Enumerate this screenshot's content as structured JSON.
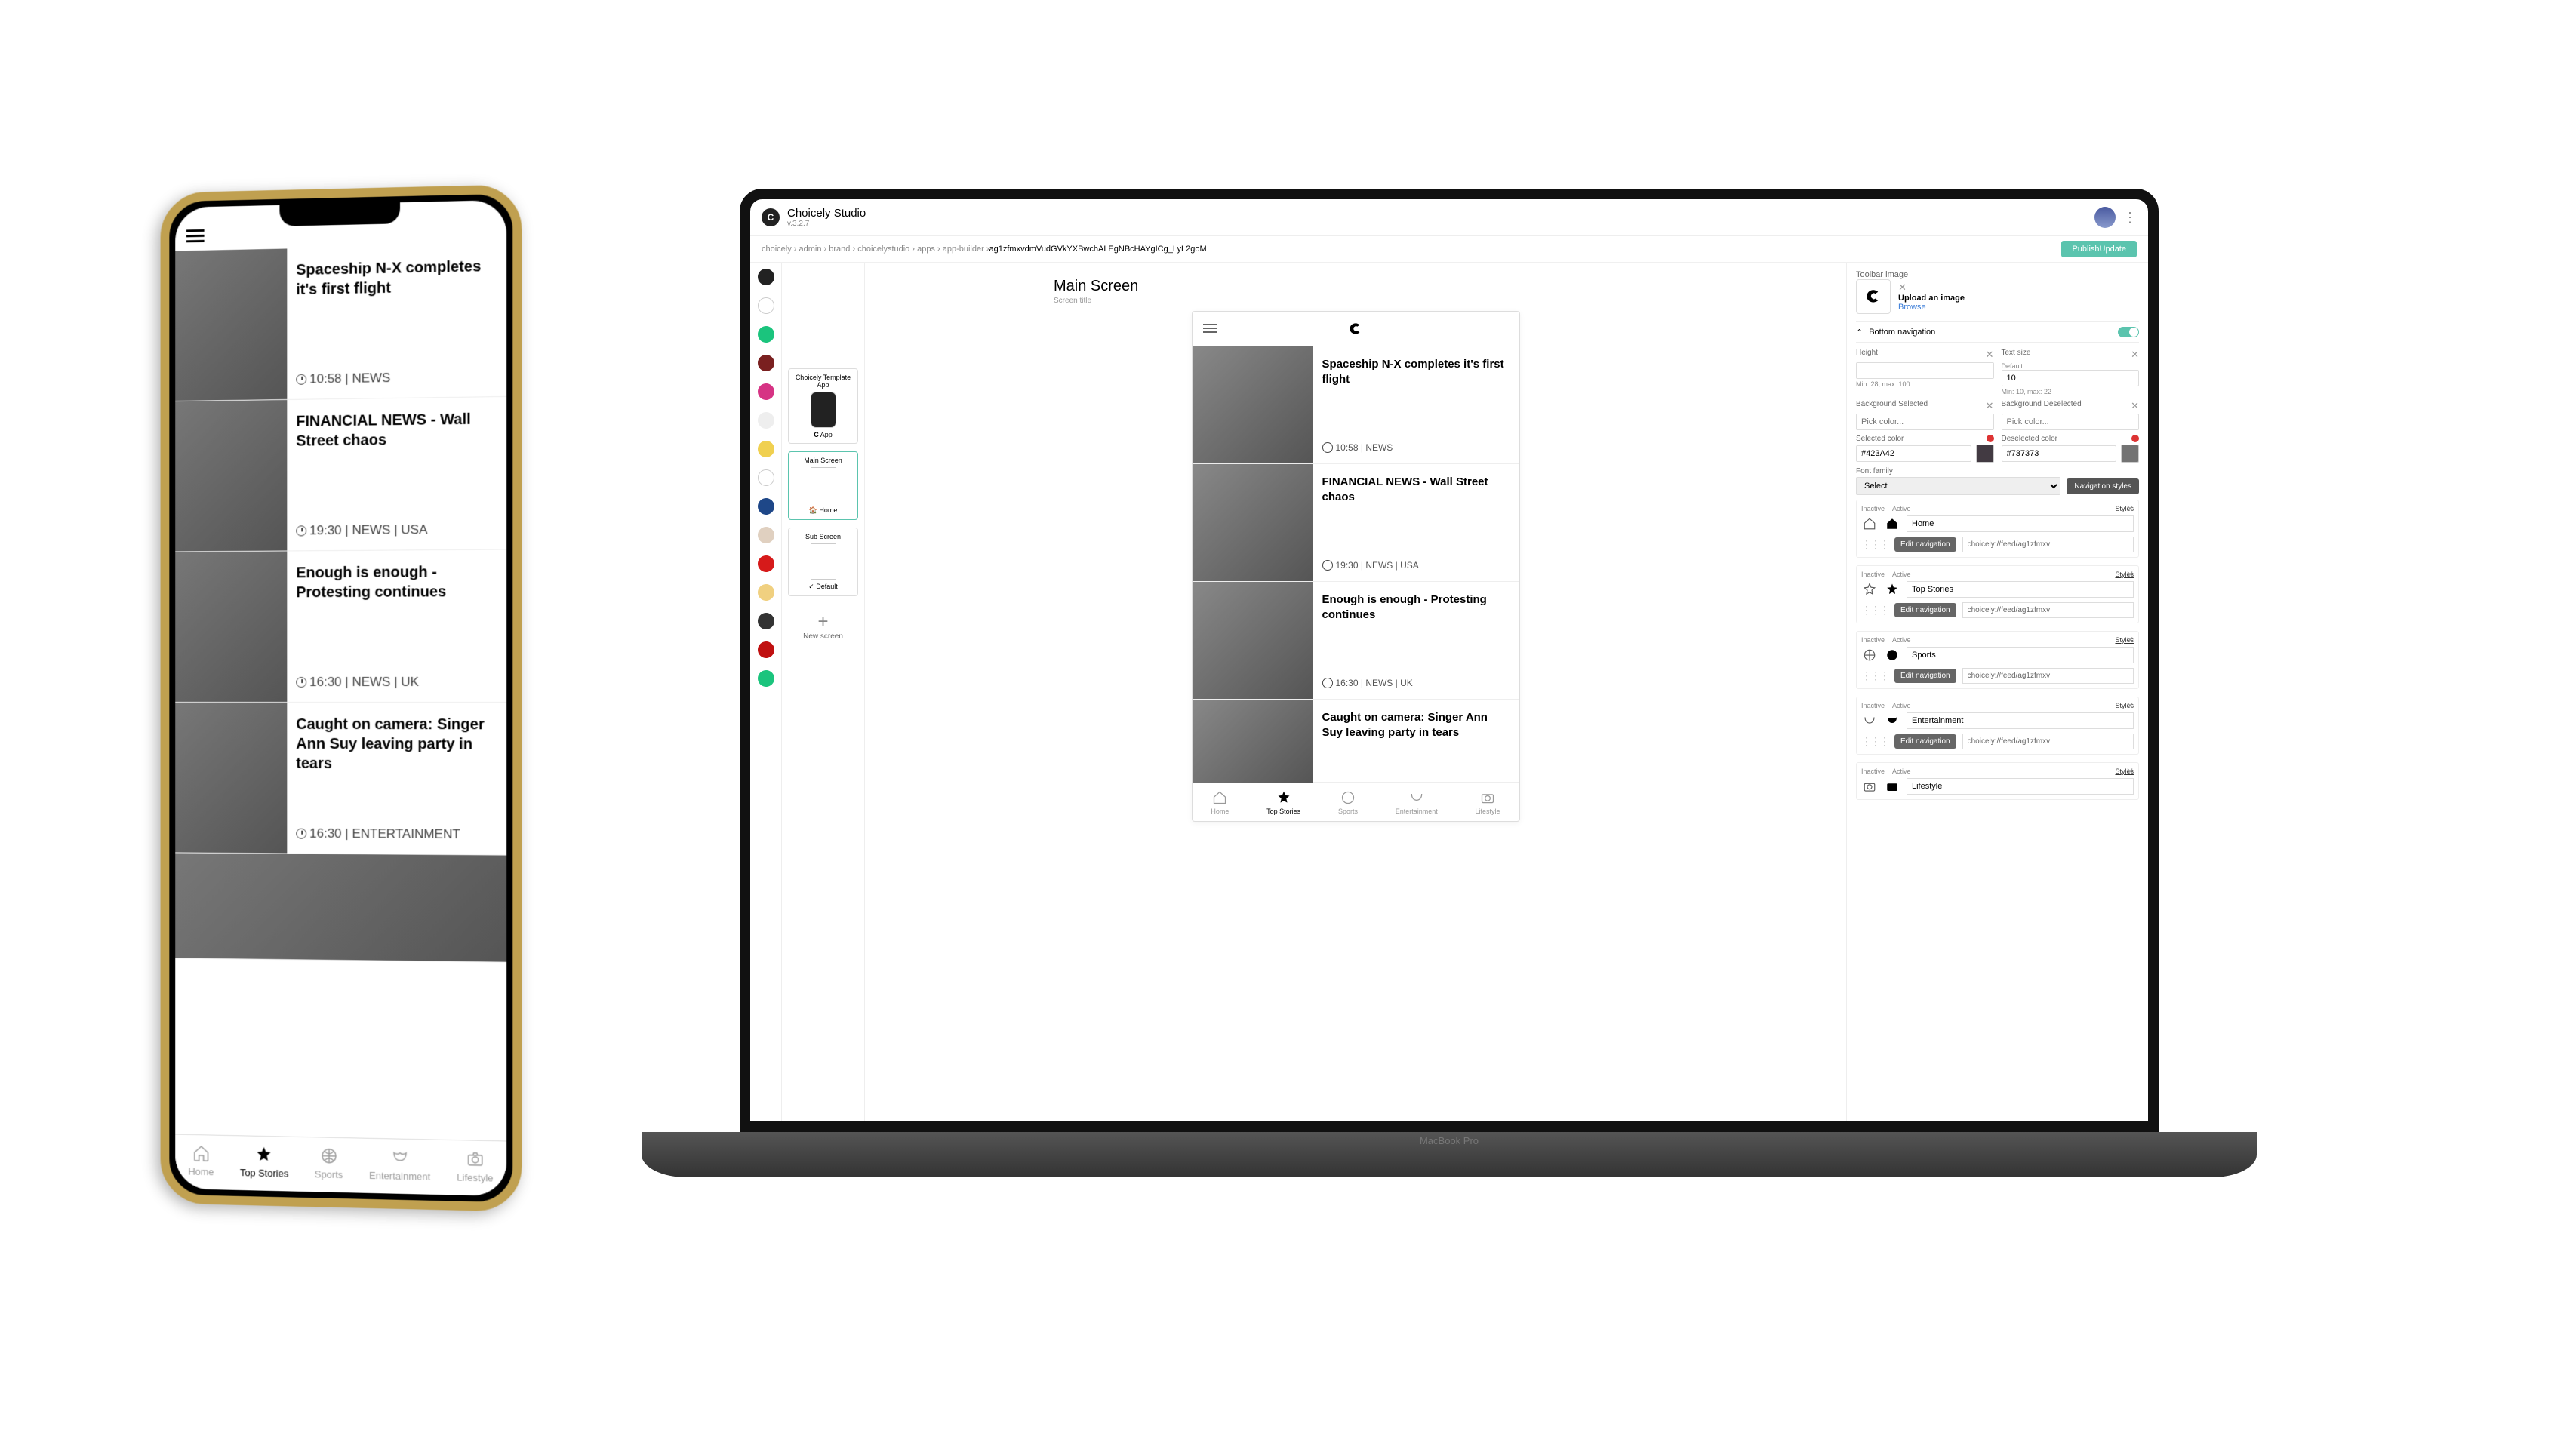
{
  "phone": {
    "tabs": [
      {
        "label": "Home"
      },
      {
        "label": "Top Stories",
        "active": true
      },
      {
        "label": "Sports"
      },
      {
        "label": "Entertainment"
      },
      {
        "label": "Lifestyle"
      }
    ],
    "news": [
      {
        "title": "Spaceship N-X completes it's first flight",
        "meta": "10:58 | NEWS"
      },
      {
        "title": "FINANCIAL NEWS - Wall Street chaos",
        "meta": "19:30 | NEWS | USA"
      },
      {
        "title": "Enough is enough - Protesting continues",
        "meta": "16:30 | NEWS | UK"
      },
      {
        "title": "Caught on camera: Singer Ann Suy leaving party in tears",
        "meta": "16:30 | ENTERTAINMENT"
      }
    ]
  },
  "studio": {
    "title": "Choicely Studio",
    "version": "v.3.2.7",
    "breadcrumb": [
      "choicely",
      "admin",
      "brand",
      "choicelystudio",
      "apps",
      "app-builder"
    ],
    "breadcrumb_id": "ag1zfmxvdmVudGVkYXBwchALEgNBcHAYgICg_LyL2goM",
    "publish_btn": "PublishUpdate",
    "template_app": "Choicely Template App",
    "app_label": "App",
    "screens": {
      "main": {
        "title": "Main Screen",
        "sub": "Home"
      },
      "sub": {
        "title": "Sub Screen",
        "sub": "Default"
      },
      "new": "New screen"
    },
    "canvas": {
      "heading": "Main Screen",
      "sub": "Screen title",
      "tabs": [
        {
          "label": "Home"
        },
        {
          "label": "Top Stories",
          "active": true
        },
        {
          "label": "Sports"
        },
        {
          "label": "Entertainment"
        },
        {
          "label": "Lifestyle"
        }
      ],
      "news": [
        {
          "title": "Spaceship N-X completes it's first flight",
          "meta": "10:58 | NEWS"
        },
        {
          "title": "FINANCIAL NEWS - Wall Street chaos",
          "meta": "19:30 | NEWS | USA"
        },
        {
          "title": "Enough is enough - Protesting continues",
          "meta": "16:30 | NEWS | UK"
        },
        {
          "title": "Caught on camera: Singer Ann Suy leaving party in tears",
          "meta": ""
        }
      ]
    }
  },
  "inspector": {
    "toolbar_image_label": "Toolbar image",
    "upload_label": "Upload an image",
    "browse": "Browse",
    "bottom_nav": "Bottom navigation",
    "height_label": "Height",
    "height_hint": "Min: 28, max: 100",
    "text_size_label": "Text size",
    "text_size_value": "10",
    "text_size_default": "Default",
    "text_size_hint": "Min: 10, max: 22",
    "bg_selected": "Background Selected",
    "bg_deselected": "Background Deselected",
    "pick_color": "Pick color...",
    "sel_color_label": "Selected color",
    "sel_color": "#423A42",
    "desel_color_label": "Deselected color",
    "desel_color": "#737373",
    "font_family": "Font family",
    "select": "Select",
    "nav_styles": "Navigation styles",
    "inactive": "Inactive",
    "active": "Active",
    "styles": "Styles",
    "edit_nav": "Edit navigation",
    "url_prefix": "choicely://feed/ag1zfmxv",
    "items": [
      {
        "label": "Home"
      },
      {
        "label": "Top Stories"
      },
      {
        "label": "Sports"
      },
      {
        "label": "Entertainment"
      },
      {
        "label": "Lifestyle"
      }
    ]
  }
}
